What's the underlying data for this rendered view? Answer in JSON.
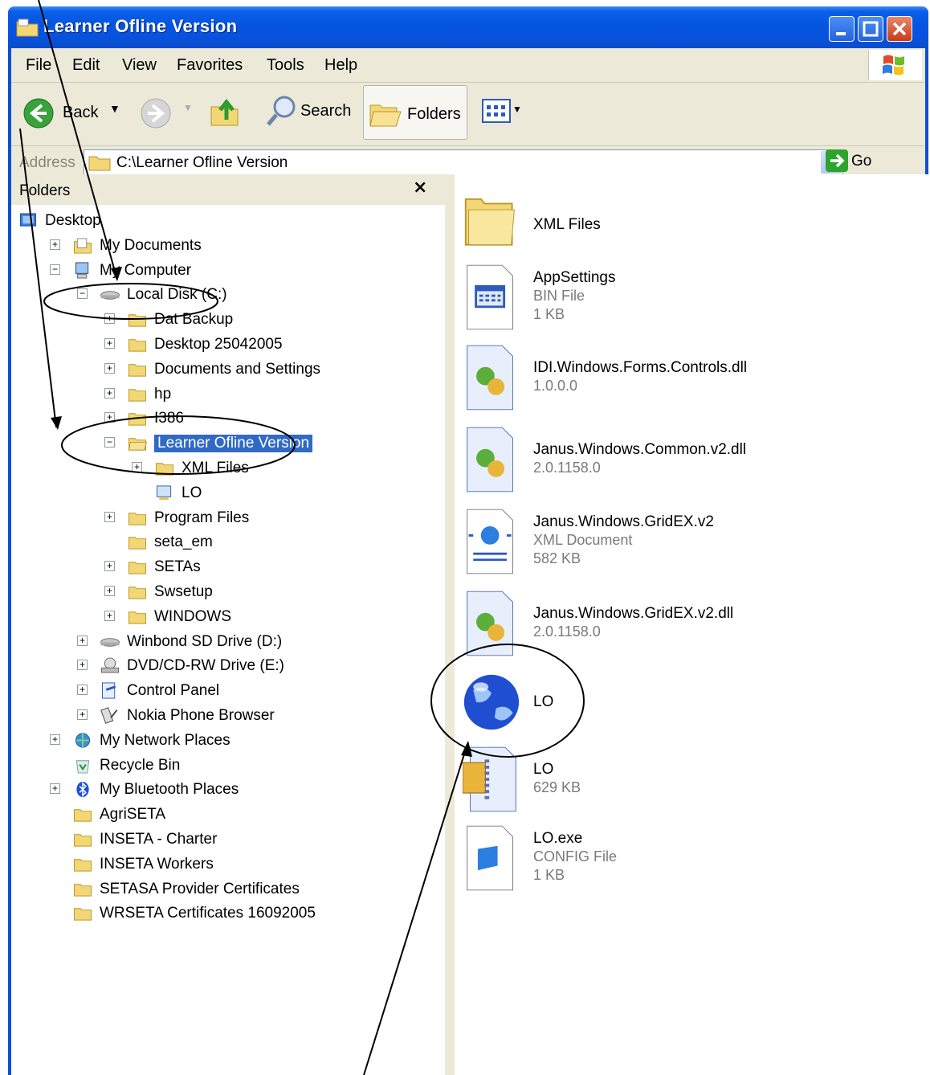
{
  "window": {
    "title": "Learner Ofline Version"
  },
  "menu": [
    "File",
    "Edit",
    "View",
    "Favorites",
    "Tools",
    "Help"
  ],
  "toolbar": {
    "back": "Back",
    "search": "Search",
    "folders": "Folders"
  },
  "address": {
    "label": "Address",
    "path": "C:\\Learner Ofline Version",
    "go": "Go"
  },
  "folders_pane": {
    "title": "Folders",
    "close": "×",
    "tree": [
      {
        "label": "Desktop",
        "expander": ""
      },
      {
        "label": "My Documents",
        "expander": "+"
      },
      {
        "label": "My Computer",
        "expander": "−"
      },
      {
        "label": "Local Disk (C:)",
        "expander": "−"
      },
      {
        "label": "Dat Backup",
        "expander": "+"
      },
      {
        "label": "Desktop 25042005",
        "expander": "+"
      },
      {
        "label": "Documents and Settings",
        "expander": "+"
      },
      {
        "label": "hp",
        "expander": "+"
      },
      {
        "label": "I386",
        "expander": "+"
      },
      {
        "label": "Learner Ofline Version",
        "expander": "−"
      },
      {
        "label": "XML Files",
        "expander": "+"
      },
      {
        "label": "LO",
        "expander": ""
      },
      {
        "label": "Program Files",
        "expander": "+"
      },
      {
        "label": "seta_em",
        "expander": ""
      },
      {
        "label": "SETAs",
        "expander": "+"
      },
      {
        "label": "Swsetup",
        "expander": "+"
      },
      {
        "label": "WINDOWS",
        "expander": "+"
      },
      {
        "label": "Winbond SD Drive (D:)",
        "expander": "+"
      },
      {
        "label": "DVD/CD-RW Drive (E:)",
        "expander": "+"
      },
      {
        "label": "Control Panel",
        "expander": "+"
      },
      {
        "label": "Nokia Phone Browser",
        "expander": "+"
      },
      {
        "label": "My Network Places",
        "expander": "+"
      },
      {
        "label": "Recycle Bin",
        "expander": ""
      },
      {
        "label": "My Bluetooth Places",
        "expander": "+"
      },
      {
        "label": "AgriSETA",
        "expander": ""
      },
      {
        "label": "INSETA - Charter",
        "expander": ""
      },
      {
        "label": "INSETA Workers",
        "expander": ""
      },
      {
        "label": "SETASA Provider Certificates",
        "expander": ""
      },
      {
        "label": "WRSETA Certificates 16092005",
        "expander": ""
      }
    ]
  },
  "files": [
    {
      "name": "XML Files",
      "type": "",
      "size": "",
      "icon": "folder-icon"
    },
    {
      "name": "AppSettings",
      "type": "BIN File",
      "size": "1 KB",
      "icon": "bin-file-icon"
    },
    {
      "name": "IDI.Windows.Forms.Controls.dll",
      "type": "1.0.0.0",
      "size": "",
      "icon": "dll-icon"
    },
    {
      "name": "Janus.Windows.Common.v2.dll",
      "type": "2.0.1158.0",
      "size": "",
      "icon": "dll-icon"
    },
    {
      "name": "Janus.Windows.GridEX.v2",
      "type": "XML Document",
      "size": "582 KB",
      "icon": "xml-document-icon"
    },
    {
      "name": "Janus.Windows.GridEX.v2.dll",
      "type": "2.0.1158.0",
      "size": "",
      "icon": "dll-icon"
    },
    {
      "name": "LO",
      "type": "",
      "size": "",
      "icon": "globe-app-icon"
    },
    {
      "name": "LO",
      "type": "",
      "size": "629 KB",
      "icon": "compressed-icon"
    },
    {
      "name": "LO.exe",
      "type": "CONFIG File",
      "size": "1 KB",
      "icon": "config-file-icon"
    }
  ],
  "colors": {
    "title_blue": "#0554e0",
    "selection": "#316ac5",
    "chrome": "#ece9d8"
  }
}
